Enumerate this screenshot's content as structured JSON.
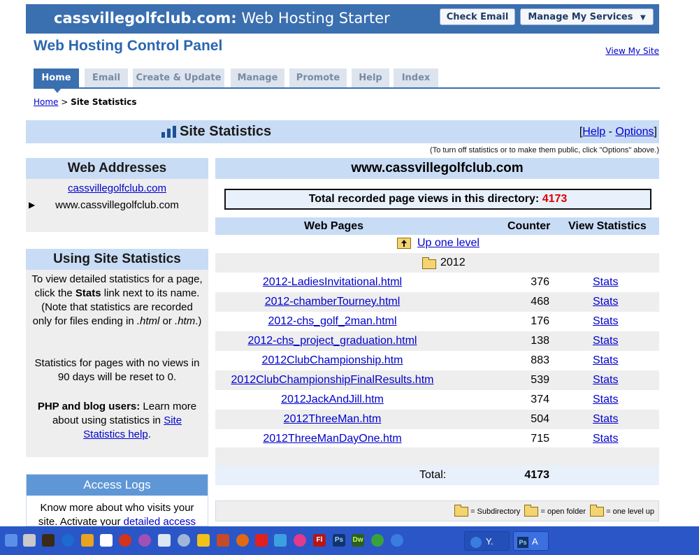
{
  "header": {
    "site_bold": "cassvillegolfclub.com:",
    "site_rest": " Web Hosting Starter",
    "check_email": "Check Email",
    "manage_services": "Manage My Services",
    "manage_arrow": "▼"
  },
  "panel_title": "Web Hosting Control Panel",
  "view_site": "View My Site",
  "tabs": [
    "Home",
    "Email",
    "Create & Update",
    "Manage",
    "Promote",
    "Help",
    "Index"
  ],
  "breadcrumb": {
    "home": "Home",
    "sep": " > ",
    "current": "Site Statistics"
  },
  "stats": {
    "title": "Site Statistics",
    "help": "Help",
    "dash": " - ",
    "options": "Options",
    "note": "(To turn off statistics or to make them public, click \"Options\" above.)"
  },
  "web_addresses": {
    "title": "Web Addresses",
    "link": "cassvillegolfclub.com",
    "current": "www.cassvillegolfclub.com",
    "pointer": "▶"
  },
  "using": {
    "title": "Using Site Statistics",
    "p1a": "To view detailed statistics for a page, click the ",
    "p1b": "Stats",
    "p1c": " link next to its name. (Note that statistics are recorded only for files ending in ",
    "p1d": ".html",
    "p1e": " or ",
    "p1f": ".htm",
    "p1g": ".)",
    "p2": "Statistics for pages with no views in 90 days will be reset to 0.",
    "p3a": "PHP and blog users:",
    "p3b": " Learn more about using statistics in ",
    "p3c": "Site Statistics help",
    "p3d": "."
  },
  "access_logs": {
    "title": "Access Logs",
    "text": "Know more about who visits your site. Activate your ",
    "link": "detailed access"
  },
  "main": {
    "domain": "www.cassvillegolfclub.com",
    "total_label": "Total recorded page views in this directory: ",
    "total_value": "4173",
    "col_pages": "Web Pages",
    "col_counter": "Counter",
    "col_stats": "View Statistics",
    "up_level": "Up one level",
    "folder": "2012",
    "rows": [
      {
        "page": "2012-LadiesInvitational.html",
        "count": "376",
        "stats": "Stats"
      },
      {
        "page": "2012-chamberTourney.html",
        "count": "468",
        "stats": "Stats"
      },
      {
        "page": "2012-chs_golf_2man.html",
        "count": "176",
        "stats": "Stats"
      },
      {
        "page": "2012-chs_project_graduation.html",
        "count": "138",
        "stats": "Stats"
      },
      {
        "page": "2012ClubChampionship.htm",
        "count": "883",
        "stats": "Stats"
      },
      {
        "page": "2012ClubChampionshipFinalResults.htm",
        "count": "539",
        "stats": "Stats"
      },
      {
        "page": "2012JackAndJill.htm",
        "count": "374",
        "stats": "Stats"
      },
      {
        "page": "2012ThreeMan.htm",
        "count": "504",
        "stats": "Stats"
      },
      {
        "page": "2012ThreeManDayOne.htm",
        "count": "715",
        "stats": "Stats"
      }
    ],
    "total_row_label": "Total:",
    "total_row_value": "4173",
    "legend_sub": " = Subdirectory ",
    "legend_open": " = open folder ",
    "legend_up": " = one level up"
  },
  "taskbar": {
    "task1": "Y.",
    "task2": "A",
    "ps_label": "Ps",
    "fl_label": "Fl",
    "dw_label": "Dw"
  }
}
